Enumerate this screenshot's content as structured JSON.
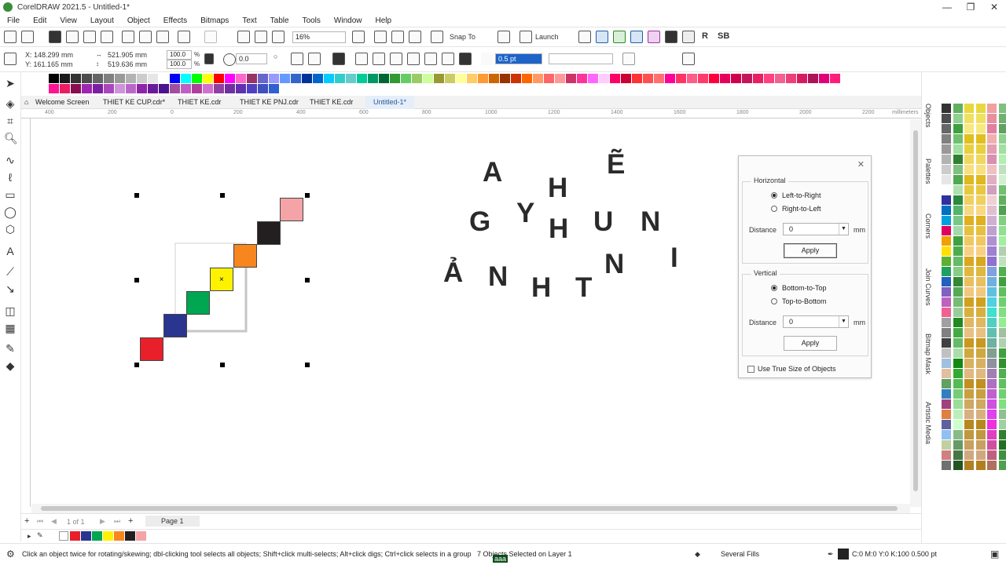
{
  "window": {
    "title": "CorelDRAW 2021.5 - Untitled-1*",
    "minimize": "—",
    "restore": "❐",
    "close": "✕"
  },
  "menu": [
    "File",
    "Edit",
    "View",
    "Layout",
    "Object",
    "Effects",
    "Bitmaps",
    "Text",
    "Table",
    "Tools",
    "Window",
    "Help"
  ],
  "toolbar": {
    "zoom": "16%",
    "snap_to": "Snap To",
    "launch": "Launch",
    "r_label": "R",
    "sb_label": "SB"
  },
  "property_bar": {
    "x": "X: 148.299 mm",
    "y": "Y: 161.165 mm",
    "width": "521.905 mm",
    "height": "519.636 mm",
    "scale_w": "100.0",
    "scale_h": "100.0",
    "percent": "%",
    "rotation": "0.0",
    "outline_width": "0.5 pt"
  },
  "tabs": [
    "Welcome Screen",
    "THIET KE CUP.cdr*",
    "THIET KE.cdr",
    "THIET KE PNJ.cdr",
    "THIET KE.cdr",
    "Untitled-1*"
  ],
  "ruler": {
    "ticks": [
      "400",
      "200",
      "0",
      "200",
      "400",
      "600",
      "800",
      "1000",
      "1200",
      "1400",
      "1600",
      "1800",
      "2000",
      "2200"
    ],
    "unit": "millimeters"
  },
  "canvas_letters": [
    "A",
    "Ẽ",
    "H",
    "G",
    "Y",
    "H",
    "U",
    "N",
    "N",
    "I",
    "Ả",
    "N",
    "H",
    "T"
  ],
  "canvas_marker": "×",
  "stair_colors": [
    "#e8202a",
    "#2a3590",
    "#00a651",
    "#fff200",
    "#f7861e",
    "#231f20",
    "#f4a4a6"
  ],
  "dialog": {
    "close": "✕",
    "horizontal": {
      "title": "Horizontal",
      "option1": "Left-to-Right",
      "option2": "Right-to-Left",
      "distance_label": "Distance",
      "distance": "0",
      "unit": "mm",
      "apply": "Apply"
    },
    "vertical": {
      "title": "Vertical",
      "option1": "Bottom-to-Top",
      "option2": "Top-to-Bottom",
      "distance_label": "Distance",
      "distance": "0",
      "unit": "mm",
      "apply": "Apply"
    },
    "checkbox": "Use True Size of Objects"
  },
  "dockers": [
    "Objects",
    "Palettes",
    "Corners",
    "Join Curves",
    "Bitmap Mask",
    "Artistic Media"
  ],
  "page_nav": {
    "count": "1 of 1",
    "page": "Page 1"
  },
  "status": {
    "hint": "Click an object twice for rotating/skewing; dbl-clicking tool selects all objects; Shift+click multi-selects; Alt+click digs; Ctrl+click selects in a group",
    "selection": "7 Objects Selected on Layer 1",
    "fill": "Several Fills",
    "outline": "C:0 M:0 Y:0 K:100  0.500 pt",
    "overlay": "aaa"
  },
  "palette_top": [
    "#000000",
    "#1a1a1a",
    "#333333",
    "#4d4d4d",
    "#666666",
    "#808080",
    "#999999",
    "#b3b3b3",
    "#cccccc",
    "#e6e6e6",
    "#ffffff",
    "#0000ff",
    "#00ffff",
    "#00ff00",
    "#ffff00",
    "#ff0000",
    "#ff00ff",
    "#ff66cc",
    "#993366",
    "#6666cc",
    "#9999ff",
    "#6699ff",
    "#3366cc",
    "#003399",
    "#0066cc",
    "#00ccff",
    "#33cccc",
    "#66cccc",
    "#00cc99",
    "#009966",
    "#006633",
    "#339933",
    "#66cc66",
    "#99cc66",
    "#ccff99",
    "#999933",
    "#cccc66",
    "#ffff99",
    "#ffcc66",
    "#ff9933",
    "#cc6600",
    "#993300",
    "#cc3300",
    "#ff6600",
    "#ff9966",
    "#ff6666",
    "#ff9999",
    "#cc3366",
    "#ff3399",
    "#ff66ff",
    "#ffccff",
    "#ff0066",
    "#cc0033",
    "#ff3333",
    "#ff5050",
    "#ff7070",
    "#ff0099",
    "#ff3366",
    "#ff5c8a",
    "#ff3b6b",
    "#ff003c",
    "#e6005c",
    "#d1004d",
    "#c2185b",
    "#e91e63",
    "#ff4081",
    "#f06292",
    "#ec407a",
    "#d81b60",
    "#ad1457",
    "#e0007a",
    "#ff1f7a"
  ],
  "palette_bottom": [
    "#ff1493",
    "#e91e63",
    "#880e4f",
    "#9c27b0",
    "#7b1fa2",
    "#ab47bc",
    "#ce93d8",
    "#ba68c8",
    "#8e24aa",
    "#6a1b9a",
    "#4a148c",
    "#a0509f",
    "#c060c0",
    "#b0409e",
    "#d070d0",
    "#9040a0",
    "#7030a0",
    "#6030b0",
    "#5040c0",
    "#4050c0",
    "#3060d0"
  ],
  "doc_palette": [
    "#e8202a",
    "#2a3590",
    "#00a651",
    "#fff200",
    "#f7861e",
    "#231f20",
    "#f4a4a6"
  ]
}
